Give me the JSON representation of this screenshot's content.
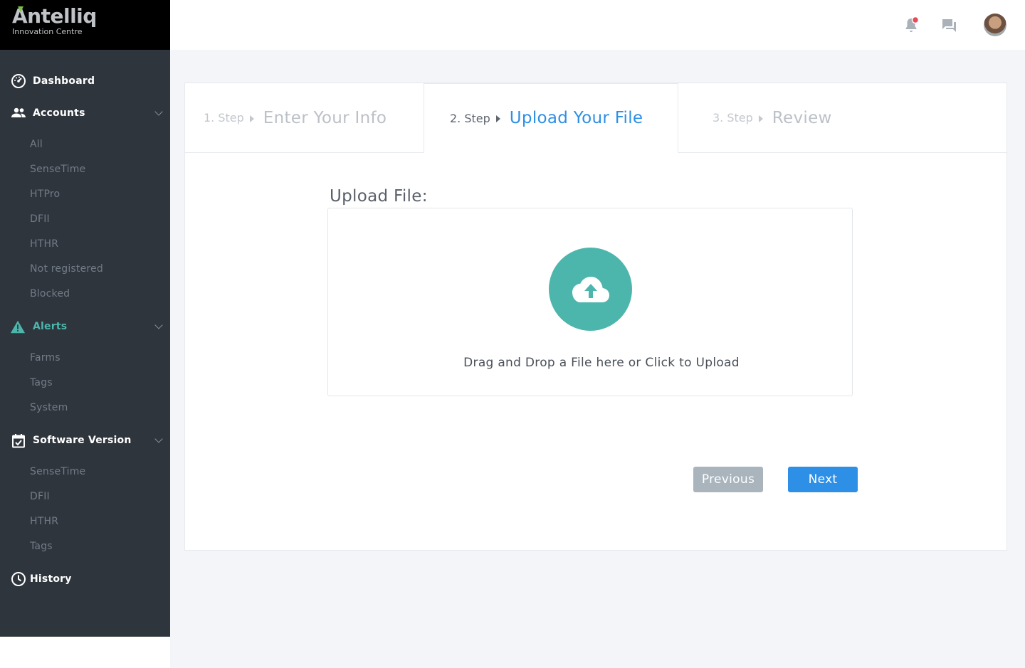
{
  "brand": {
    "name": "Antelliq",
    "subtitle": "Innovation Centre",
    "accent": "#7cc242"
  },
  "sidebar": {
    "dashboard": "Dashboard",
    "accounts": {
      "label": "Accounts",
      "items": [
        "All",
        "SenseTime",
        "HTPro",
        "DFII",
        "HTHR",
        "Not registered",
        "Blocked"
      ]
    },
    "alerts": {
      "label": "Alerts",
      "color": "#4db6ac",
      "items": [
        "Farms",
        "Tags",
        "System"
      ]
    },
    "software_version": {
      "label": "Software Version",
      "items": [
        "SenseTime",
        "DFII",
        "HTHR",
        "Tags"
      ]
    },
    "history": "History"
  },
  "header": {
    "icons": [
      "bell-icon",
      "chat-icon",
      "avatar"
    ],
    "notification_dot_color": "#e74c5c"
  },
  "wizard": {
    "steps": [
      {
        "num": "1. Step",
        "title": "Enter Your Info",
        "state": "done"
      },
      {
        "num": "2. Step",
        "title": "Upload Your File",
        "state": "active"
      },
      {
        "num": "3. Step",
        "title": "Review",
        "state": "pending"
      }
    ],
    "upload_label": "Upload File:",
    "dropzone_text": "Drag and Drop a File here or Click to Upload",
    "previous_label": "Previous",
    "next_label": "Next",
    "active_color": "#2d8fe6",
    "upload_color": "#4db6ac"
  }
}
